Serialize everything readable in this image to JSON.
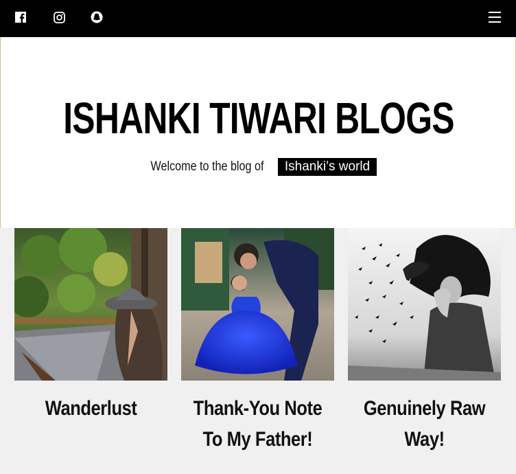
{
  "topbar": {
    "social": [
      {
        "icon": "facebook-icon"
      },
      {
        "icon": "instagram-icon"
      },
      {
        "icon": "snapchat-icon"
      }
    ],
    "menu_icon": "hamburger-menu-icon"
  },
  "hero": {
    "title": "ISHANKI TIWARI BLOGS",
    "tagline_prefix": "Welcome to the blog of",
    "tagline_highlight": "Ishanki’s world"
  },
  "posts": [
    {
      "title": "Wanderlust",
      "image": "woman-in-hat-on-train-photo"
    },
    {
      "title": "Thank-You Note To My Father!",
      "image": "father-kissing-daughter-blue-dress-photo"
    },
    {
      "title": "Genuinely Raw Way!",
      "image": "woman-hair-birds-bw-photo"
    }
  ],
  "colors": {
    "topbar_bg": "#000000",
    "hero_bg": "#ffffff",
    "page_bg": "#f0f0f0",
    "highlight_bg": "#000000"
  }
}
